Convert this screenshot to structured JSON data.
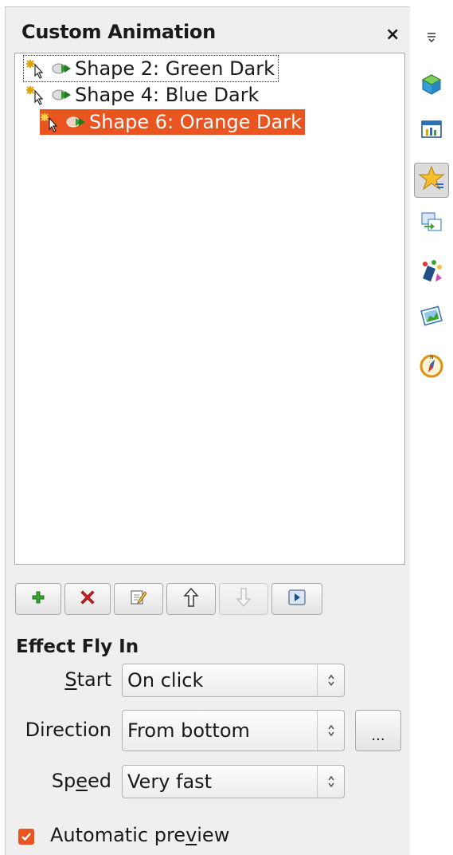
{
  "panel": {
    "title": "Custom Animation",
    "close_label": "×"
  },
  "animation_list": {
    "items": [
      {
        "label": "Shape 2: Green Dark",
        "selected": false
      },
      {
        "label": "Shape 4: Blue Dark",
        "selected": false
      },
      {
        "label": "Shape 6: Orange Dark",
        "selected": true
      }
    ]
  },
  "toolbar": {
    "buttons": [
      {
        "name": "add-effect-button",
        "icon": "plus-icon",
        "enabled": true
      },
      {
        "name": "remove-effect-button",
        "icon": "red-x-icon",
        "enabled": true
      },
      {
        "name": "change-effect-button",
        "icon": "edit-icon",
        "enabled": true
      },
      {
        "name": "move-up-button",
        "icon": "arrow-up-icon",
        "enabled": true
      },
      {
        "name": "move-down-button",
        "icon": "arrow-down-icon",
        "enabled": false
      },
      {
        "name": "play-button",
        "icon": "play-icon",
        "enabled": true
      }
    ]
  },
  "effect": {
    "heading": "Effect Fly In",
    "start": {
      "label_pre": "",
      "label_u": "S",
      "label_post": "tart",
      "value": "On click"
    },
    "direction": {
      "label": "Direction",
      "value": "From bottom",
      "more_label": "..."
    },
    "speed": {
      "label_pre": "Sp",
      "label_u": "e",
      "label_post": "ed",
      "value": "Very fast"
    }
  },
  "automatic_preview": {
    "label_pre": "Automatic pre",
    "label_u": "v",
    "label_post": "iew",
    "checked": true
  },
  "sidebar": {
    "menu_icon": "sidebar-menu-icon",
    "tabs": [
      {
        "icon": "properties-cube-icon",
        "active": false
      },
      {
        "icon": "master-slides-icon",
        "active": false
      },
      {
        "icon": "custom-animation-star-icon",
        "active": true
      },
      {
        "icon": "slide-transition-icon",
        "active": false
      },
      {
        "icon": "styles-icon",
        "active": false
      },
      {
        "icon": "gallery-icon",
        "active": false
      },
      {
        "icon": "navigator-compass-icon",
        "active": false
      }
    ]
  },
  "colors": {
    "accent": "#e95420",
    "panel_bg": "#efefef",
    "list_bg": "#ffffff"
  }
}
